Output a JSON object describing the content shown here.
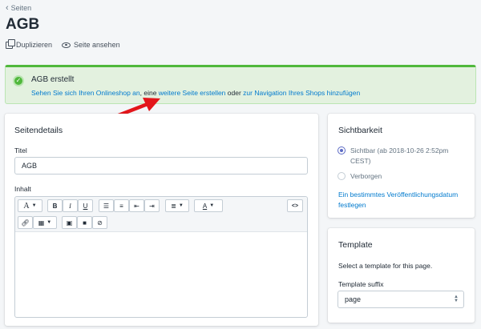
{
  "nav": {
    "back_label": "Seiten"
  },
  "page": {
    "title": "AGB"
  },
  "actions": {
    "duplicate_label": "Duplizieren",
    "view_label": "Seite ansehen"
  },
  "banner": {
    "title": "AGB erstellt",
    "link_storefront": "Sehen Sie sich Ihren Onlineshop an",
    "sep1": ", eine ",
    "link_create": "weitere Seite erstellen",
    "sep2": " oder ",
    "link_navigation": "zur Navigation Ihres Shops hinzufügen",
    "status_color": "#50b83c"
  },
  "details": {
    "heading": "Seitendetails",
    "title_label": "Titel",
    "title_value": "AGB",
    "content_label": "Inhalt"
  },
  "editor_toolbar": {
    "row1": [
      "A",
      "B",
      "I",
      "U",
      "list-bulleted-icon",
      "list-numbered-icon",
      "outdent-icon",
      "indent-icon",
      "align-icon",
      "text-color-icon",
      "<>"
    ],
    "row2": [
      "link-icon",
      "table-icon",
      "image-icon",
      "video-icon",
      "clear-format-icon"
    ]
  },
  "visibility": {
    "heading": "Sichtbarkeit",
    "option_visible": "Sichtbar (ab 2018-10-26 2:52pm CEST)",
    "option_hidden": "Verborgen",
    "selected": "visible",
    "schedule_link": "Ein bestimmtes Veröffentlichungsdatum festlegen"
  },
  "template": {
    "heading": "Template",
    "description": "Select a template for this page.",
    "suffix_label": "Template suffix",
    "suffix_value": "page"
  },
  "colors": {
    "link": "#007ace",
    "accent": "#5c6ac4",
    "annotation_arrow": "#e3161b"
  }
}
